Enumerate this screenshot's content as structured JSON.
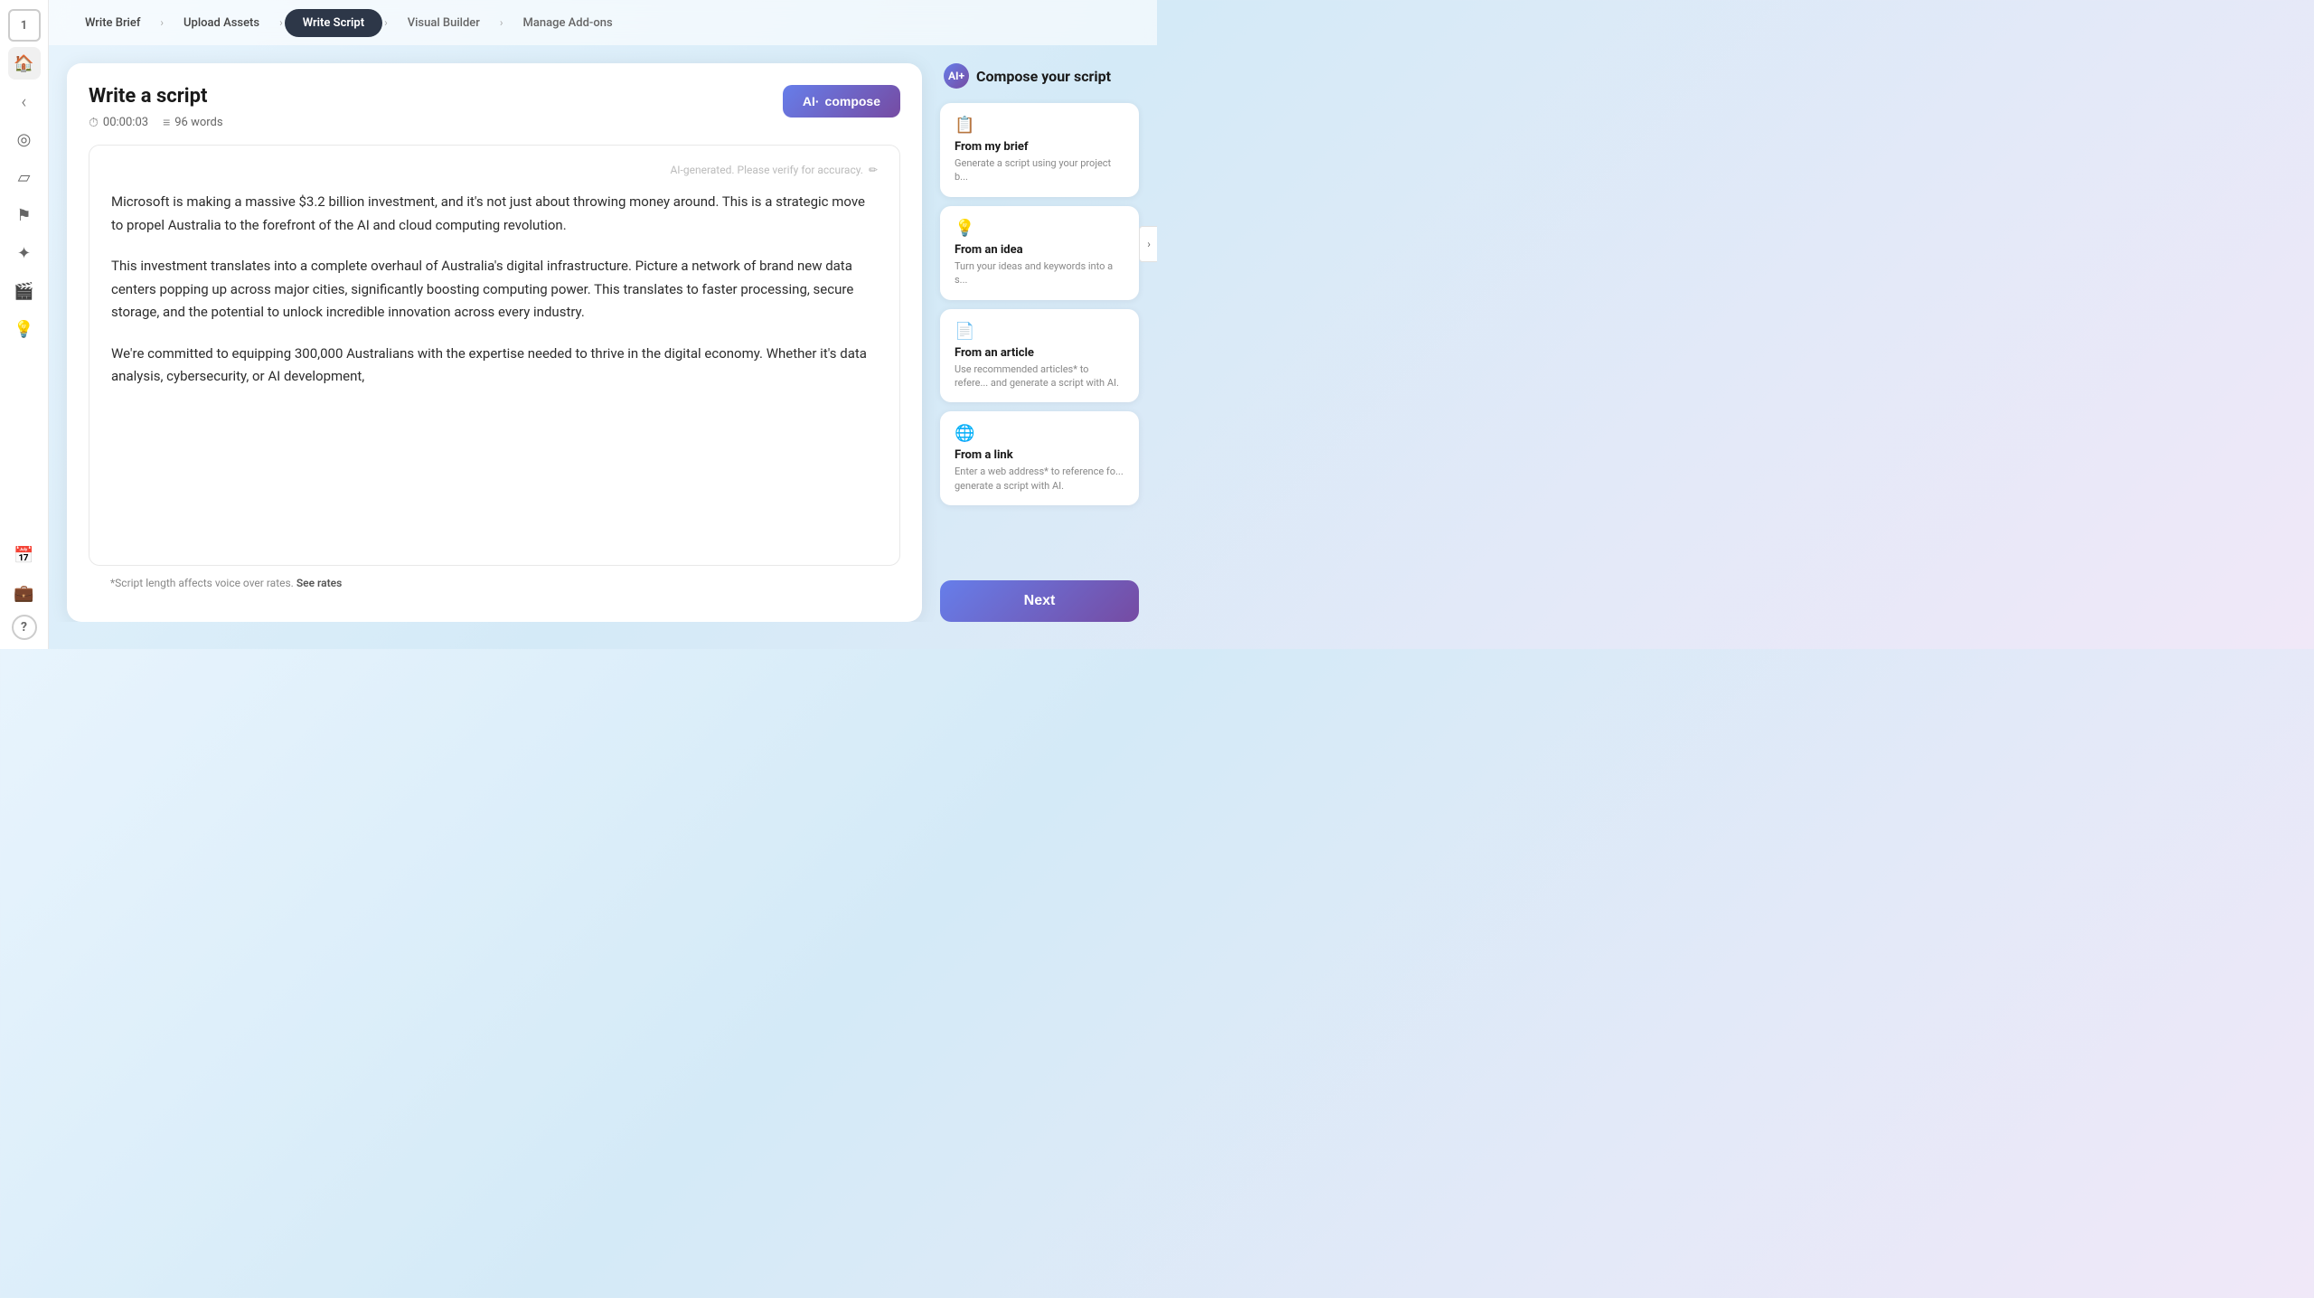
{
  "sidebar": {
    "num_label": "1",
    "icons": [
      {
        "name": "home-icon",
        "symbol": "🏠"
      },
      {
        "name": "back-icon",
        "symbol": "‹"
      },
      {
        "name": "target-icon",
        "symbol": "◎"
      },
      {
        "name": "frame-icon",
        "symbol": "▱"
      },
      {
        "name": "flag-icon",
        "symbol": "⚑"
      },
      {
        "name": "magic-icon",
        "symbol": "✦"
      },
      {
        "name": "camera-icon",
        "symbol": "🎬"
      },
      {
        "name": "lightbulb-icon",
        "symbol": "💡"
      },
      {
        "name": "calendar-icon",
        "symbol": "📅"
      },
      {
        "name": "briefcase-icon",
        "symbol": "💼"
      },
      {
        "name": "help-icon",
        "symbol": "?"
      }
    ]
  },
  "nav": {
    "steps": [
      {
        "label": "Write Brief",
        "state": "completed"
      },
      {
        "label": "Upload Assets",
        "state": "completed"
      },
      {
        "label": "Write Script",
        "state": "active"
      },
      {
        "label": "Visual Builder",
        "state": "default"
      },
      {
        "label": "Manage Add-ons",
        "state": "default"
      }
    ]
  },
  "script_panel": {
    "title": "Write a script",
    "time": "00:00:03",
    "words": "96 words",
    "ai_compose_label": "compose",
    "ai_label": "AI·",
    "ai_notice": "AI-generated. Please verify for accuracy.",
    "content": [
      "Microsoft is making a massive $3.2 billion investment, and it's not just about throwing money around. This is a strategic move to propel Australia to the forefront of the AI and cloud computing revolution.",
      "This investment translates into a complete overhaul of Australia's digital infrastructure. Picture a network of brand new data centers popping up across major cities, significantly boosting computing power. This translates to faster processing, secure storage, and the potential to unlock incredible innovation across every industry.",
      "We're committed to equipping 300,000 Australians with the expertise needed to thrive in the digital economy. Whether it's data analysis, cybersecurity, or AI development,"
    ],
    "footer_note": "*Script length affects voice over rates.",
    "see_rates_label": "See rates"
  },
  "right_panel": {
    "ai_logo": "AI+",
    "compose_title": "Compose your script",
    "options": [
      {
        "icon": "📋",
        "title": "From my brief",
        "desc": "Generate a script using your project b..."
      },
      {
        "icon": "💡",
        "title": "From an idea",
        "desc": "Turn your ideas and keywords into a s..."
      },
      {
        "icon": "📄",
        "title": "From an article",
        "desc": "Use recommended articles* to refere... and generate a script with AI."
      },
      {
        "icon": "🌐",
        "title": "From a link",
        "desc": "Enter a web address* to reference fo... generate a script with AI."
      }
    ],
    "next_label": "Next"
  }
}
